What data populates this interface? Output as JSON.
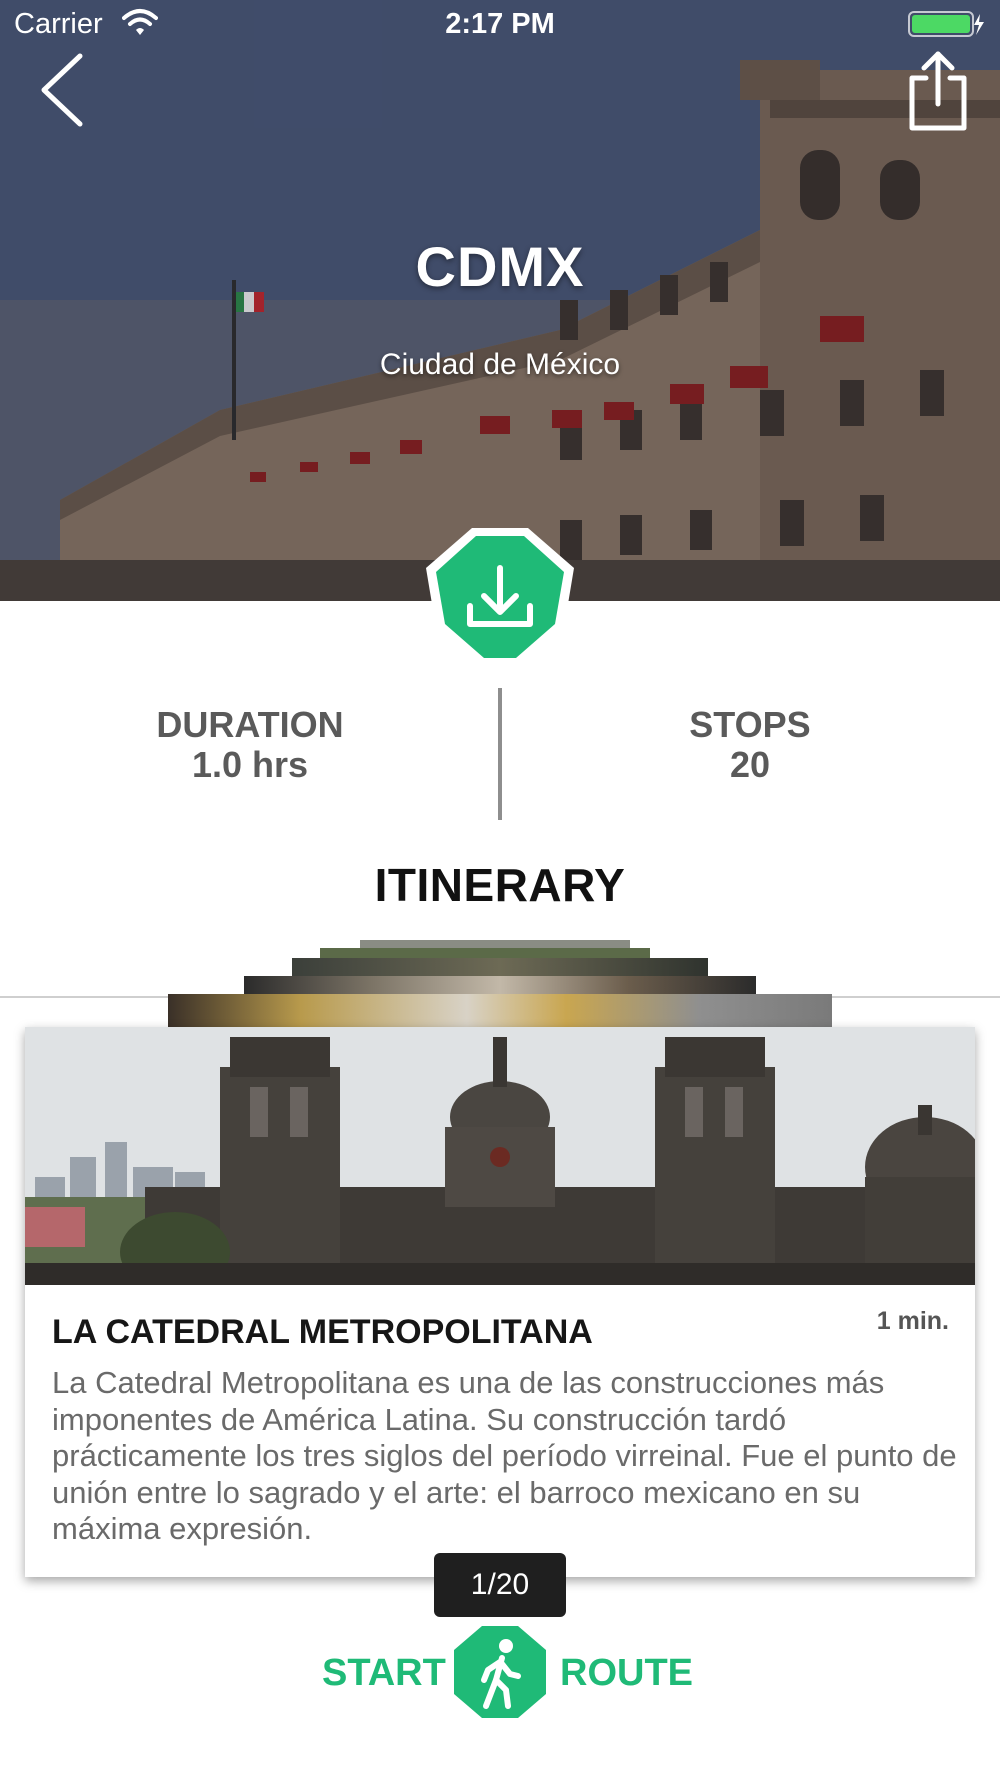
{
  "status_bar": {
    "carrier": "Carrier",
    "time": "2:17 PM",
    "icons": [
      "wifi-icon",
      "battery-icon"
    ]
  },
  "header": {
    "back_icon": "chevron-left-icon",
    "share_icon": "share-icon",
    "title": "CDMX",
    "subtitle": "Ciudad de México",
    "download_icon": "download-icon"
  },
  "stats": {
    "duration_label": "DURATION",
    "duration_value": "1.0 hrs",
    "stops_label": "STOPS",
    "stops_value": "20"
  },
  "itinerary": {
    "heading": "ITINERARY",
    "current_stop": {
      "title": "LA CATEDRAL METROPOLITANA",
      "duration": "1 min.",
      "description": "La Catedral Metropolitana es una de las construcciones más imponentes de América Latina. Su construcción tardó prácticamente los tres siglos del período virreinal. Fue el punto de unión entre lo sagrado y el arte: el barroco mexicano en su máxima expresión."
    },
    "pager": "1/20"
  },
  "actions": {
    "start_label": "START",
    "route_label": "ROUTE",
    "walk_icon": "walking-person-icon"
  },
  "colors": {
    "accent_green": "#1fba77",
    "pager_bg": "#1f1f1f",
    "stat_text": "#5a5a5a",
    "body_text": "#6a6a6a"
  }
}
